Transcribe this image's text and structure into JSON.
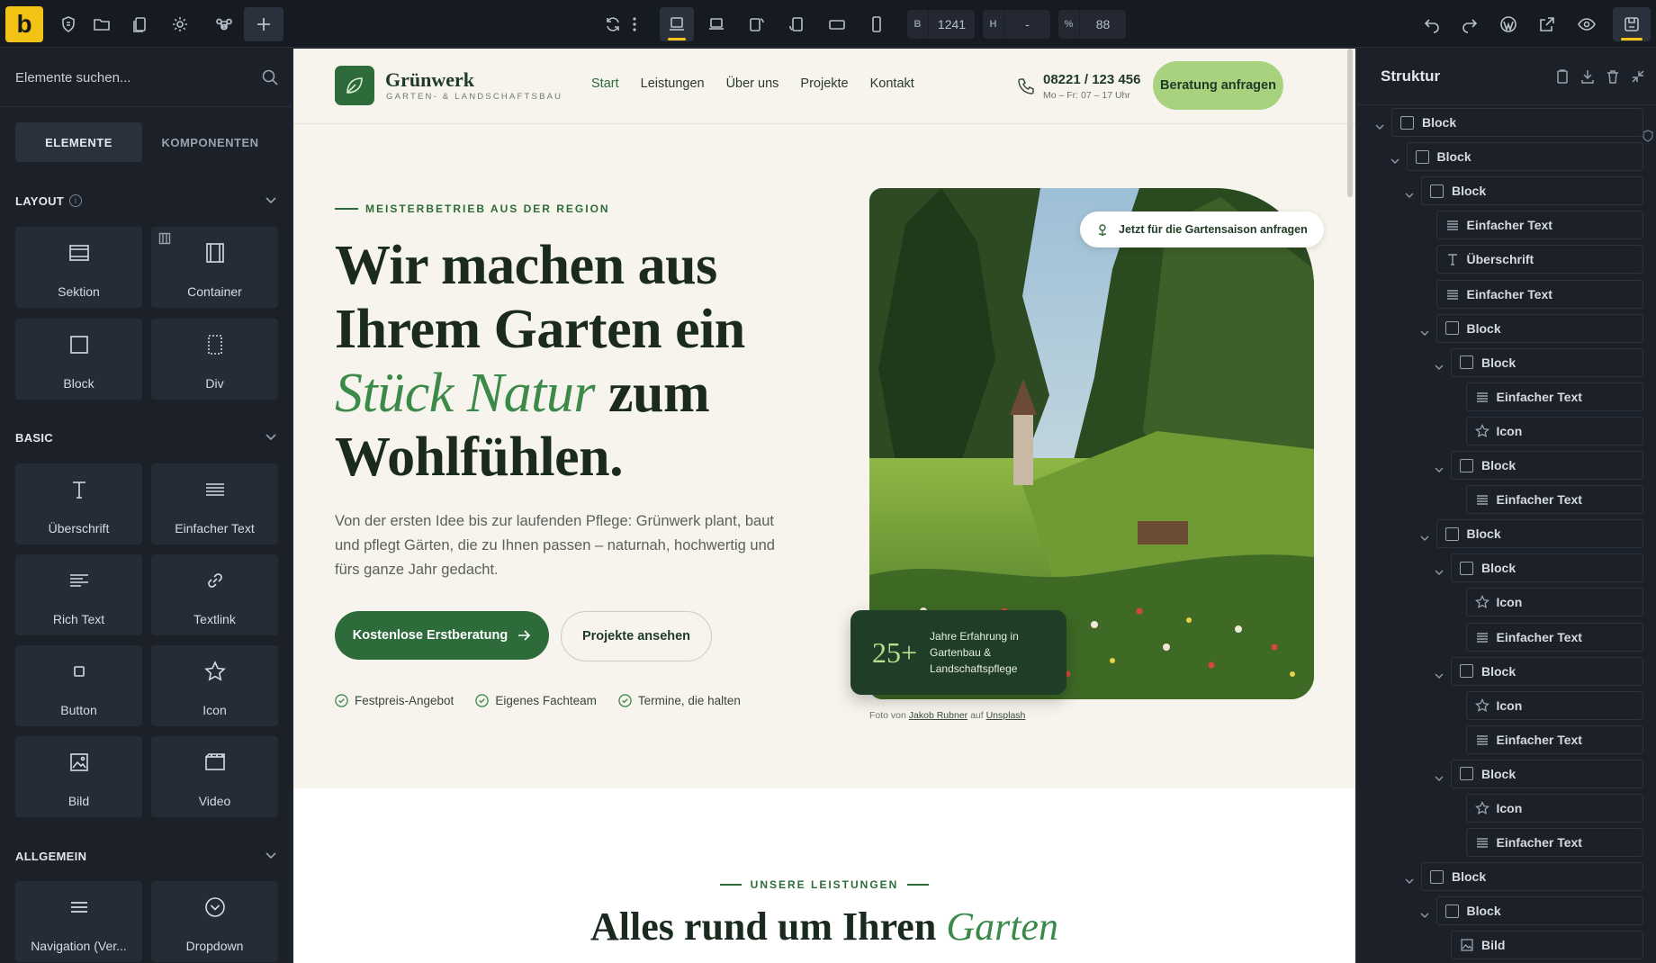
{
  "toolbar": {
    "logo": "b",
    "width_label": "B",
    "width_value": "1241",
    "height_label": "H",
    "height_value": "-",
    "zoom_label": "%",
    "zoom_value": "88"
  },
  "left_panel": {
    "search_placeholder": "Elemente suchen...",
    "tabs": [
      "ELEMENTE",
      "KOMPONENTEN"
    ],
    "sections": {
      "layout": "LAYOUT",
      "basic": "BASIC",
      "allgemein": "ALLGEMEIN"
    },
    "layout_items": [
      "Sektion",
      "Container",
      "Block",
      "Div"
    ],
    "basic_items": [
      "Überschrift",
      "Einfacher Text",
      "Rich Text",
      "Textlink",
      "Button",
      "Icon",
      "Bild",
      "Video"
    ],
    "general_items": [
      "Navigation (Ver...",
      "Dropdown"
    ]
  },
  "site": {
    "brand_name": "Grünwerk",
    "brand_sub": "GARTEN- & LANDSCHAFTSBAU",
    "nav": [
      "Start",
      "Leistungen",
      "Über uns",
      "Projekte",
      "Kontakt"
    ],
    "phone": "08221 / 123 456",
    "hours": "Mo – Fr: 07 – 17 Uhr",
    "cta": "Beratung anfragen",
    "eyebrow": "MEISTERBETRIEB AUS DER REGION",
    "h1_line1": "Wir machen aus",
    "h1_line2": "Ihrem Garten ein",
    "h1_em": "Stück Natur",
    "h1_line3_rest": " zum",
    "h1_line4": "Wohlfühlen.",
    "lead": "Von der ersten Idee bis zur laufenden Pflege: Grünwerk plant, baut und pflegt Gärten, die zu Ihnen passen – naturnah, hochwertig und fürs ganze Jahr gedacht.",
    "btn_primary": "Kostenlose Erstberatung",
    "btn_secondary": "Projekte ansehen",
    "checks": [
      "Festpreis-Angebot",
      "Eigenes Fachteam",
      "Termine, die halten"
    ],
    "badge": "Jetzt für die Gartensaison anfragen",
    "stat_num": "25+",
    "stat_text": "Jahre Erfahrung in Gartenbau & Landschaftspflege",
    "credit_pre": "Foto von ",
    "credit_author": "Jakob Rubner",
    "credit_mid": " auf ",
    "credit_src": "Unsplash",
    "section2_eyebrow": "UNSERE LEISTUNGEN",
    "section2_title": "Alles rund um Ihren ",
    "section2_em": "Garten"
  },
  "structure": {
    "title": "Struktur",
    "rows": [
      {
        "label": "Block",
        "icon": "box",
        "depth": 0,
        "caret": true
      },
      {
        "label": "Block",
        "icon": "box",
        "depth": 1,
        "caret": true
      },
      {
        "label": "Block",
        "icon": "box",
        "depth": 2,
        "caret": true
      },
      {
        "label": "Einfacher Text",
        "icon": "lines",
        "depth": 3,
        "caret": false
      },
      {
        "label": "Überschrift",
        "icon": "T",
        "depth": 3,
        "caret": false
      },
      {
        "label": "Einfacher Text",
        "icon": "lines",
        "depth": 3,
        "caret": false
      },
      {
        "label": "Block",
        "icon": "box",
        "depth": 3,
        "caret": true
      },
      {
        "label": "Block",
        "icon": "box",
        "depth": 4,
        "caret": true
      },
      {
        "label": "Einfacher Text",
        "icon": "lines",
        "depth": 5,
        "caret": false
      },
      {
        "label": "Icon",
        "icon": "star",
        "depth": 5,
        "caret": false
      },
      {
        "label": "Block",
        "icon": "box",
        "depth": 4,
        "caret": true
      },
      {
        "label": "Einfacher Text",
        "icon": "lines",
        "depth": 5,
        "caret": false
      },
      {
        "label": "Block",
        "icon": "box",
        "depth": 3,
        "caret": true
      },
      {
        "label": "Block",
        "icon": "box",
        "depth": 4,
        "caret": true
      },
      {
        "label": "Icon",
        "icon": "star",
        "depth": 5,
        "caret": false
      },
      {
        "label": "Einfacher Text",
        "icon": "lines",
        "depth": 5,
        "caret": false
      },
      {
        "label": "Block",
        "icon": "box",
        "depth": 4,
        "caret": true
      },
      {
        "label": "Icon",
        "icon": "star",
        "depth": 5,
        "caret": false
      },
      {
        "label": "Einfacher Text",
        "icon": "lines",
        "depth": 5,
        "caret": false
      },
      {
        "label": "Block",
        "icon": "box",
        "depth": 4,
        "caret": true
      },
      {
        "label": "Icon",
        "icon": "star",
        "depth": 5,
        "caret": false
      },
      {
        "label": "Einfacher Text",
        "icon": "lines",
        "depth": 5,
        "caret": false
      },
      {
        "label": "Block",
        "icon": "box",
        "depth": 2,
        "caret": true
      },
      {
        "label": "Block",
        "icon": "box",
        "depth": 3,
        "caret": true
      },
      {
        "label": "Bild",
        "icon": "image",
        "depth": 4,
        "caret": false
      }
    ]
  },
  "colors": {
    "accent": "#f2c214",
    "brand_green": "#2e6b3a",
    "cta_green": "#a9d27e",
    "panel_bg": "#1b2029"
  }
}
